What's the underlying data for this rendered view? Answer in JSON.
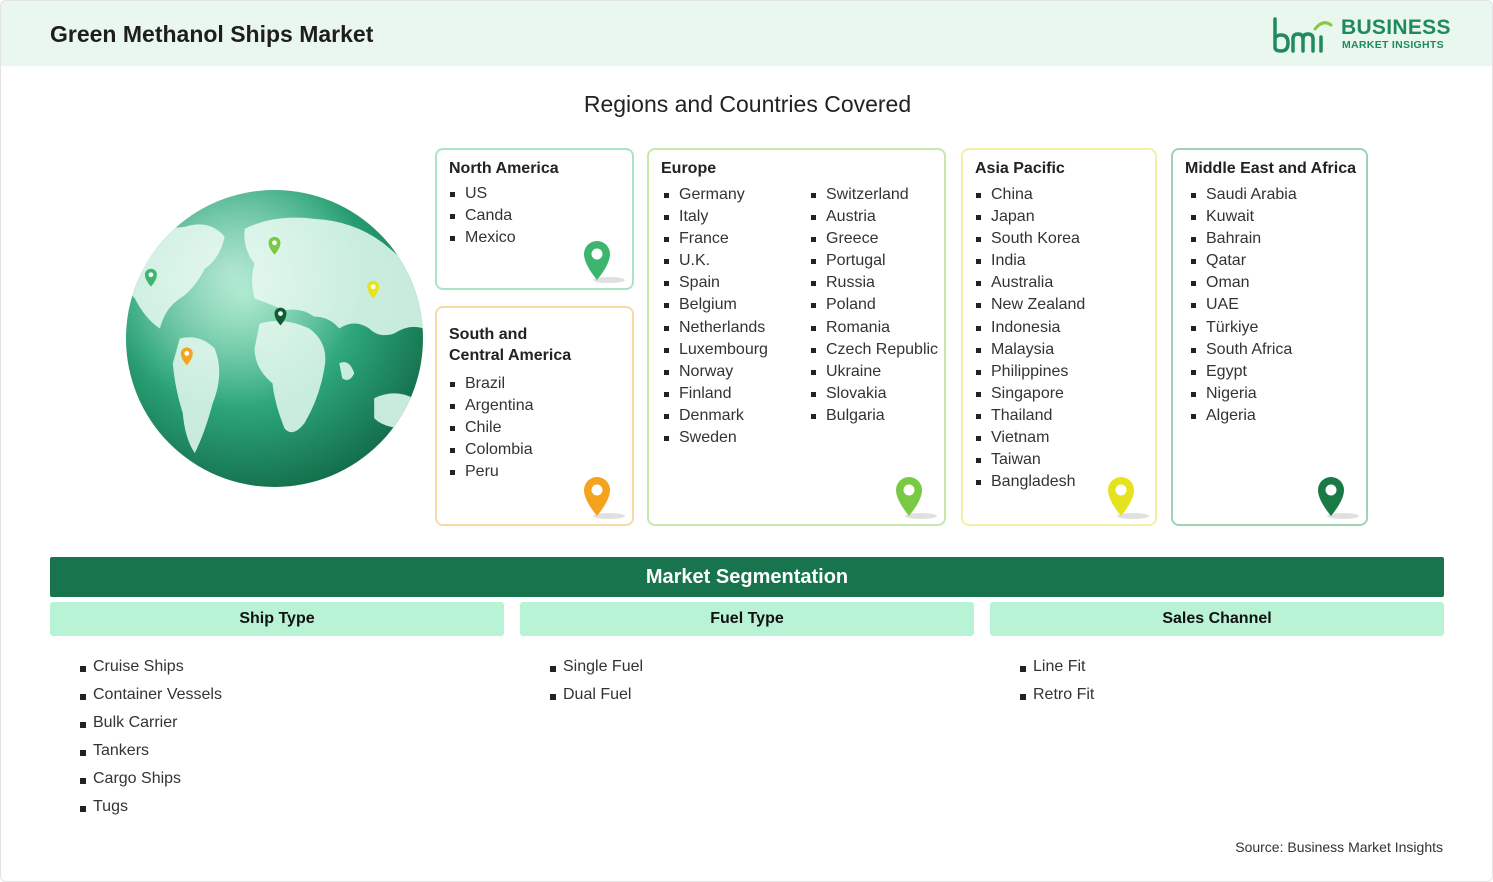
{
  "header": {
    "title": "Green Methanol Ships Market"
  },
  "logo": {
    "line1": "BUSINESS",
    "line2": "MARKET INSIGHTS"
  },
  "regions": {
    "title": "Regions and Countries Covered",
    "north_america": {
      "title": "North America",
      "items": [
        "US",
        "Canda",
        "Mexico"
      ],
      "color": "#3cb56f"
    },
    "south_america": {
      "title_line1": "South and",
      "title_line2": "Central America",
      "items": [
        "Brazil",
        "Argentina",
        "Chile",
        "Colombia",
        "Peru"
      ],
      "color": "#f5a21e"
    },
    "europe": {
      "title": "Europe",
      "col1": [
        "Germany",
        "Italy",
        "France",
        "U.K.",
        "Spain",
        "Belgium",
        "Netherlands",
        "Luxembourg",
        "Norway",
        "Finland",
        "Denmark",
        "Sweden"
      ],
      "col2": [
        "Switzerland",
        "Austria",
        "Greece",
        "Portugal",
        "Russia",
        "Poland",
        "Romania",
        "Czech Republic",
        "Ukraine",
        "Slovakia",
        "Bulgaria"
      ],
      "color": "#7ac943"
    },
    "asia_pacific": {
      "title": "Asia Pacific",
      "items": [
        "China",
        "Japan",
        "South Korea",
        "India",
        "Australia",
        "New Zealand",
        "Indonesia",
        "Malaysia",
        "Philippines",
        "Singapore",
        "Thailand",
        "Vietnam",
        "Taiwan",
        "Bangladesh"
      ],
      "color": "#e6e31e"
    },
    "mea": {
      "title": "Middle East and Africa",
      "items": [
        "Saudi Arabia",
        "Kuwait",
        "Bahrain",
        "Qatar",
        "Oman",
        "UAE",
        "Türkiye",
        "South Africa",
        "Egypt",
        "Nigeria",
        "Algeria"
      ],
      "color": "#1a7a45"
    }
  },
  "segmentation": {
    "title": "Market Segmentation",
    "ship_type": {
      "title": "Ship Type",
      "items": [
        "Cruise Ships",
        "Container Vessels",
        "Bulk Carrier",
        "Tankers",
        "Cargo Ships",
        "Tugs"
      ]
    },
    "fuel_type": {
      "title": "Fuel Type",
      "items": [
        "Single Fuel",
        "Dual Fuel"
      ]
    },
    "sales_channel": {
      "title": "Sales Channel",
      "items": [
        "Line Fit",
        "Retro Fit"
      ]
    }
  },
  "source": "Source: Business Market Insights"
}
